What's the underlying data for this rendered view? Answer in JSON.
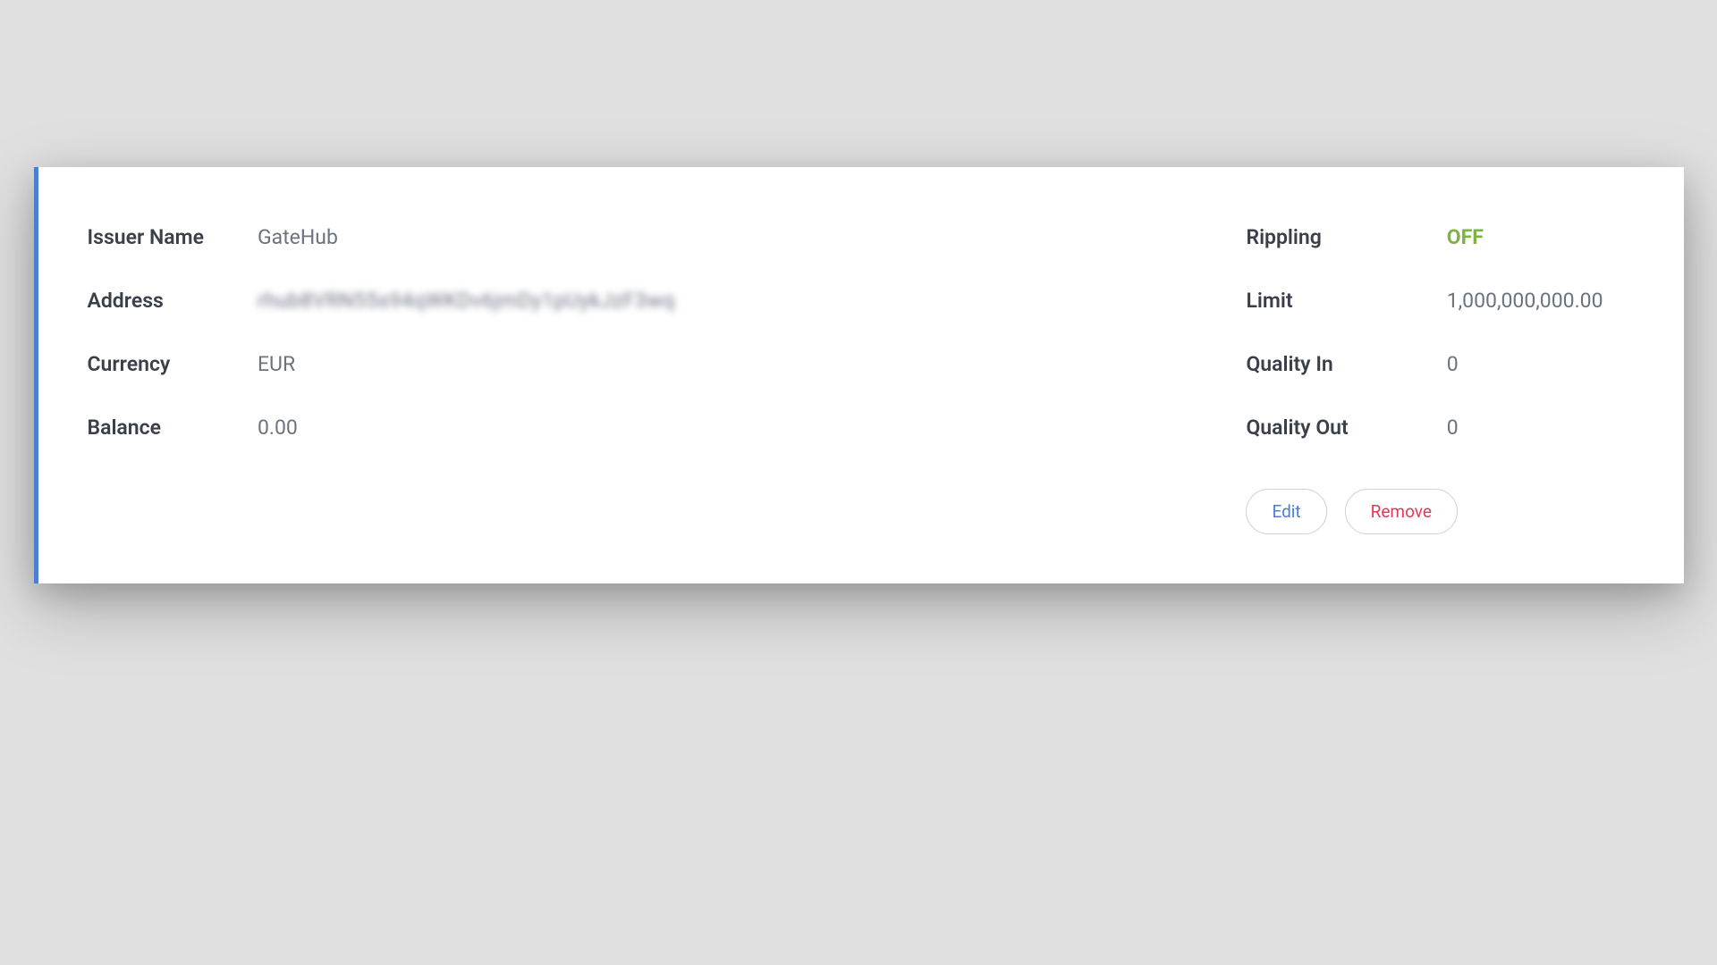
{
  "left": {
    "issuer_name_label": "Issuer Name",
    "issuer_name_value": "GateHub",
    "address_label": "Address",
    "address_value": "rhub8VRN55s94qWKDv6jmDy1pUykJzF3wq",
    "currency_label": "Currency",
    "currency_value": "EUR",
    "balance_label": "Balance",
    "balance_value": "0.00"
  },
  "right": {
    "rippling_label": "Rippling",
    "rippling_value": "OFF",
    "limit_label": "Limit",
    "limit_value": "1,000,000,000.00",
    "quality_in_label": "Quality In",
    "quality_in_value": "0",
    "quality_out_label": "Quality Out",
    "quality_out_value": "0"
  },
  "actions": {
    "edit_label": "Edit",
    "remove_label": "Remove"
  }
}
